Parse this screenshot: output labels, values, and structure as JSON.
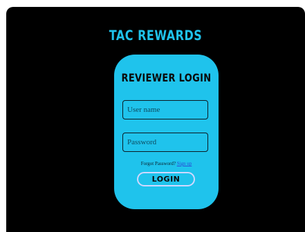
{
  "header": {
    "brand": "TAC REWARDS"
  },
  "login_card": {
    "title": "REVIEWER LOGIN",
    "username_placeholder": "User name",
    "password_placeholder": "Password",
    "forgot_text": "Forgot Password?",
    "signup_link": "Sign up",
    "login_button": "LOGIN"
  },
  "colors": {
    "background": "#000000",
    "accent": "#1fc3ec",
    "text_dark": "#0a0a0a",
    "link": "#2a4bd6"
  }
}
